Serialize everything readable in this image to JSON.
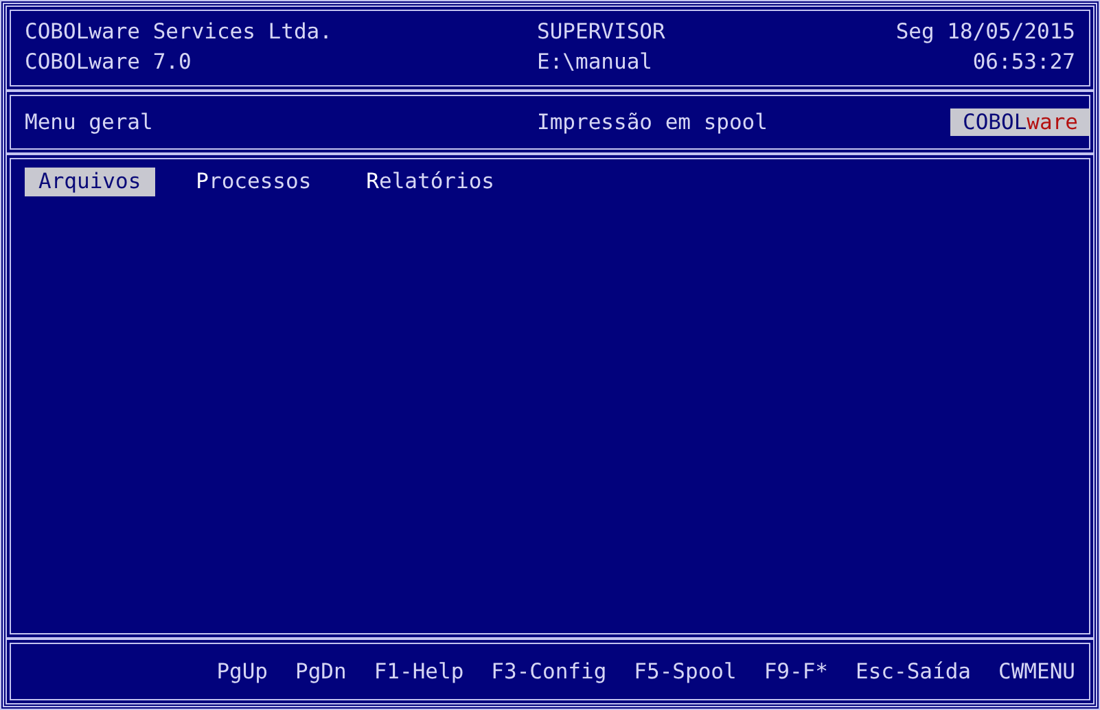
{
  "header": {
    "company": "COBOLware Services Ltda.",
    "version": "COBOLware 7.0",
    "user": "SUPERVISOR",
    "path": "E:\\manual",
    "date": "Seg 18/05/2015",
    "time": "06:53:27"
  },
  "context_bar": {
    "menu_title": "Menu geral",
    "function_title": "Impressão em spool",
    "logo": "COBOL**ware**"
  },
  "menu": [
    {
      "label": "**A**rquivos",
      "selected": true
    },
    {
      "label": "**P**rocessos",
      "selected": false
    },
    {
      "label": "**R**elatórios",
      "selected": false
    }
  ],
  "footer_keys": [
    "PgUp",
    "PgDn",
    "F1-Help",
    "F3-Config",
    "F5-Spool",
    "F9-F*",
    "Esc-Saída",
    "CWMENU"
  ]
}
